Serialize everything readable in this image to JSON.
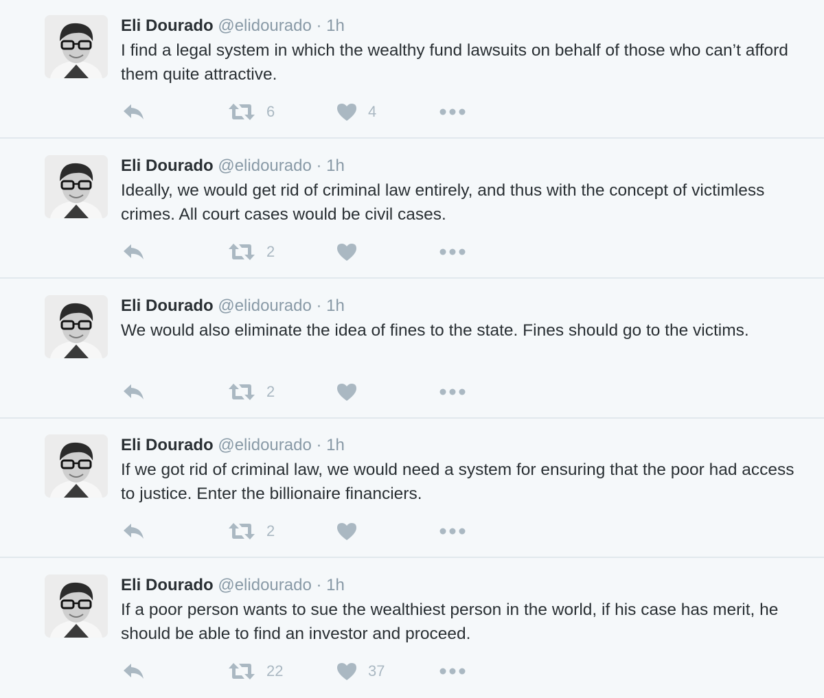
{
  "tweets": [
    {
      "name": "Eli Dourado",
      "handle": "@elidourado",
      "separator": "·",
      "time": "1h",
      "text": "I find a legal system in which the wealthy fund lawsuits on behalf of those who can’t afford them quite attractive.",
      "retweets": "6",
      "likes": "4"
    },
    {
      "name": "Eli Dourado",
      "handle": "@elidourado",
      "separator": "·",
      "time": "1h",
      "text": "Ideally, we would get rid of criminal law entirely, and thus with the concept of victimless crimes. All court cases would be civil cases.",
      "retweets": "2",
      "likes": ""
    },
    {
      "name": "Eli Dourado",
      "handle": "@elidourado",
      "separator": "·",
      "time": "1h",
      "text": "We would also eliminate the idea of fines to the state. Fines should go to the victims.",
      "retweets": "2",
      "likes": ""
    },
    {
      "name": "Eli Dourado",
      "handle": "@elidourado",
      "separator": "·",
      "time": "1h",
      "text": "If we got rid of criminal law, we would need a system for ensuring that the poor had access to justice. Enter the billionaire financiers.",
      "retweets": "2",
      "likes": ""
    },
    {
      "name": "Eli Dourado",
      "handle": "@elidourado",
      "separator": "·",
      "time": "1h",
      "text": "If a poor person wants to sue the wealthiest person in the world, if his case has merit, he should be able to find an investor and proceed.",
      "retweets": "22",
      "likes": "37"
    }
  ],
  "icons": {
    "reply": "reply-icon",
    "retweet": "retweet-icon",
    "like": "heart-icon",
    "more": "more-dots-icon",
    "avatar": "avatar"
  },
  "colors": {
    "background": "#f5f8fa",
    "text": "#292f33",
    "muted": "#8899a6",
    "icon": "#aab8c2",
    "divider": "#e1e8ed"
  }
}
